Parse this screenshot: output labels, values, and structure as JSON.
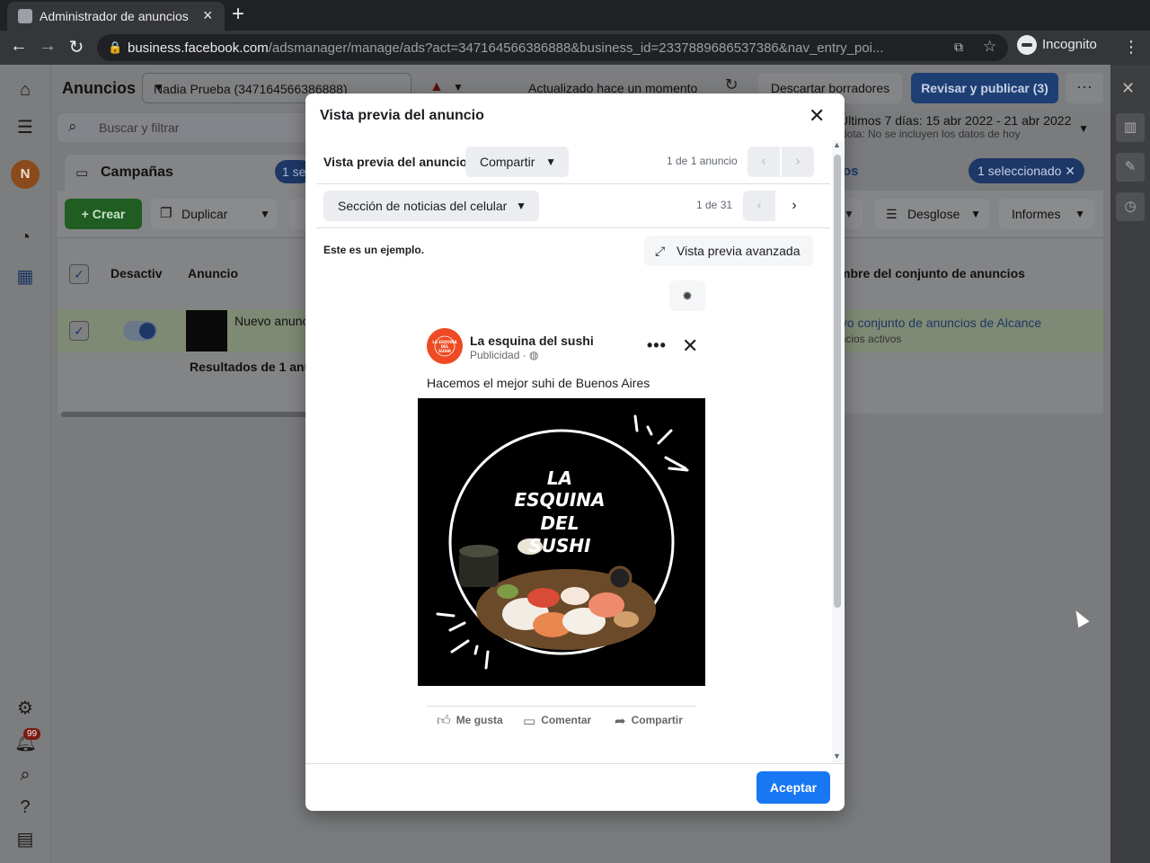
{
  "browser": {
    "tab_title": "Administrador de anuncios",
    "url_host": "business.facebook.com",
    "url_path": "/adsmanager/manage/ads?act=347164566386888&business_id=2337889686537386&nav_entry_poi...",
    "incognito_label": "Incognito"
  },
  "header": {
    "title": "Anuncios",
    "account": "Nadia Prueba (347164566386888)",
    "updated": "Actualizado hace un momento",
    "discard_label": "Descartar borradores",
    "publish_label": "Revisar y publicar (3)"
  },
  "search": {
    "placeholder": "Buscar y filtrar"
  },
  "date_range": {
    "label": "Últimos 7 días: 15 abr 2022 - 21 abr 2022",
    "note": "Nota: No se incluyen los datos de hoy"
  },
  "tabs": {
    "campaigns": "Campañas",
    "selected_left": "1 se",
    "ads_tail": "os",
    "selected": "1 seleccionado"
  },
  "toolbar": {
    "create": "Crear",
    "duplicate": "Duplicar",
    "breakdown": "Desglose",
    "reports": "Informes"
  },
  "table": {
    "col_deactivate": "Desactiv",
    "col_ad": "Anuncio",
    "col_adset": "mbre del conjunto de anuncios",
    "row_ad_name": "Nuevo anunc",
    "row_adset": "evo conjunto de anuncios de Alcance",
    "row_adset_sub": "uncios activos",
    "results": "Resultados de 1 anu"
  },
  "left_nav": {
    "avatar_initial": "N",
    "notif_count": "99"
  },
  "modal": {
    "title": "Vista previa del anuncio",
    "preview_label": "Vista previa del anuncio",
    "share_option": "Compartir",
    "ad_count": "1 de 1 anuncio",
    "placement": "Sección de noticias del celular",
    "placement_count": "1 de 31",
    "example_note": "Este es un ejemplo.",
    "advanced_preview": "Vista previa avanzada",
    "accept": "Aceptar"
  },
  "post": {
    "page_name": "La esquina del sushi",
    "sponsored": "Publicidad · ",
    "text": "Hacemos el mejor suhi de Buenos Aires",
    "logo_text": "LA ESQUINA DEL SUSHI",
    "image_text": [
      "LA",
      "ESQUINA",
      "DEL",
      "SUSHI"
    ],
    "like": "Me gusta",
    "comment": "Comentar",
    "share": "Compartir"
  },
  "colors": {
    "accent": "#1877f2",
    "create_green": "#42b72a",
    "logo_orange": "#ef4a23"
  }
}
